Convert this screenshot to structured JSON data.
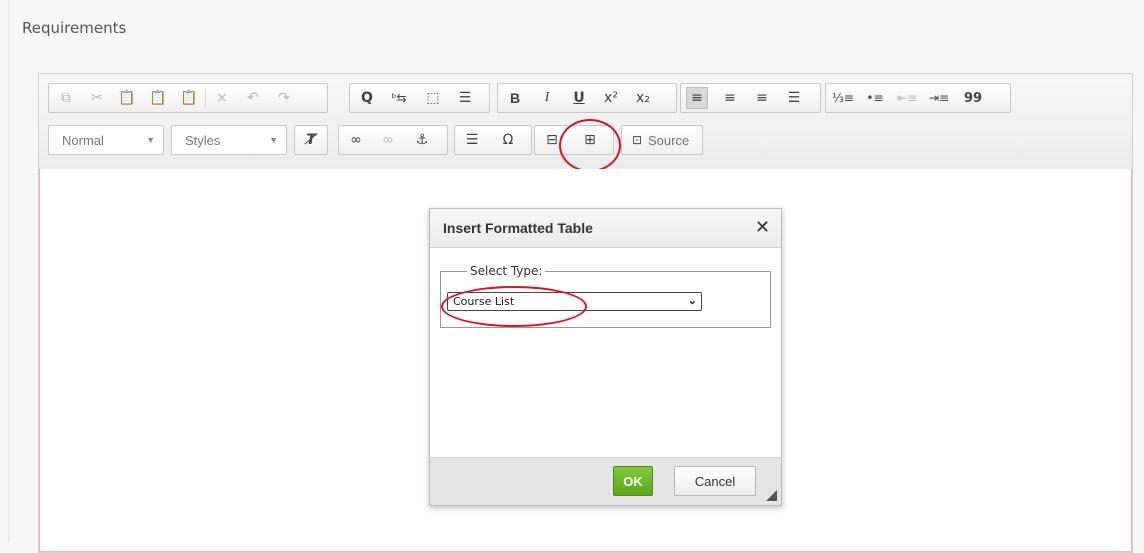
{
  "section": {
    "label": "Requirements"
  },
  "toolbar": {
    "row1": [
      {
        "group": "clipboard",
        "icons": [
          "copy-icon",
          "cut-icon",
          "paste-icon",
          "paste-text-icon",
          "paste-word-icon",
          "remove-format-sep",
          "clear-icon",
          "undo-icon",
          "redo-icon"
        ]
      },
      {
        "group": "find",
        "icons": [
          "find-icon",
          "replace-icon",
          "select-all-icon",
          "spellcheck-icon"
        ]
      },
      {
        "group": "basicstyles",
        "icons": [
          "bold-icon",
          "italic-icon",
          "underline-icon",
          "superscript-icon",
          "subscript-icon"
        ]
      },
      {
        "group": "align",
        "icons": [
          "align-left-icon",
          "align-center-icon",
          "align-right-icon",
          "justify-icon"
        ]
      },
      {
        "group": "list",
        "icons": [
          "numbered-list-icon",
          "bulleted-list-icon",
          "outdent-icon",
          "indent-icon",
          "blockquote-icon"
        ]
      }
    ],
    "format_combo": "Normal",
    "styles_combo": "Styles",
    "source_label": "Source",
    "glyphs": {
      "bold": "B",
      "italic": "I",
      "underline": "U",
      "superscript": "x²",
      "subscript": "x₂",
      "blockquote": "99",
      "omega": "Ω",
      "anchor": "⚓",
      "find": "Q"
    }
  },
  "dialog": {
    "title": "Insert Formatted Table",
    "close_glyph": "✕",
    "fieldset_legend": "Select Type:",
    "select_value": "Course List",
    "ok_label": "OK",
    "cancel_label": "Cancel"
  },
  "colors": {
    "annotation_red": "#d9141e",
    "ok_green": "#5aa51c",
    "editor_border_pink": "#f0b7b7"
  }
}
